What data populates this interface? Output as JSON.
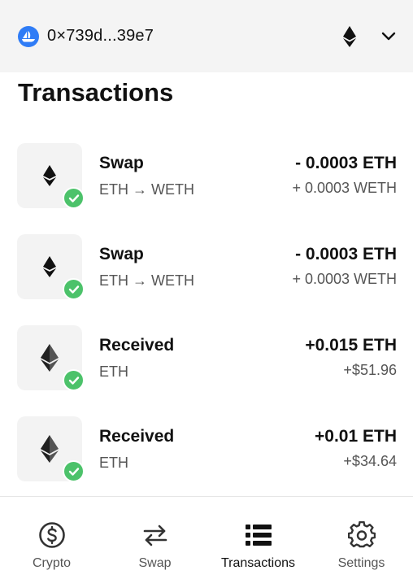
{
  "header": {
    "address": "0×739d...39e7",
    "avatar_icon": "opensea-logo",
    "network_icon": "ethereum-icon",
    "menu_icon": "chevron-down-icon"
  },
  "page": {
    "title": "Transactions"
  },
  "transactions": [
    {
      "type": "Swap",
      "detail": "ETH → WETH",
      "amount": "- 0.0003 ETH",
      "secondary": "+ 0.0003 WETH",
      "status": "success"
    },
    {
      "type": "Swap",
      "detail": "ETH → WETH",
      "amount": "- 0.0003 ETH",
      "secondary": "+ 0.0003 WETH",
      "status": "success"
    },
    {
      "type": "Received",
      "detail": "ETH",
      "amount": "+0.015 ETH",
      "secondary": "+$51.96",
      "status": "success"
    },
    {
      "type": "Received",
      "detail": "ETH",
      "amount": "+0.01 ETH",
      "secondary": "+$34.64",
      "status": "success"
    }
  ],
  "nav": {
    "items": [
      {
        "label": "Crypto",
        "icon": "dollar-circle-icon",
        "active": false
      },
      {
        "label": "Swap",
        "icon": "swap-arrows-icon",
        "active": false
      },
      {
        "label": "Transactions",
        "icon": "list-icon",
        "active": true
      },
      {
        "label": "Settings",
        "icon": "gear-icon",
        "active": false
      }
    ]
  },
  "colors": {
    "success": "#4cc26a",
    "avatar": "#2f7cf6",
    "header_bg": "#f4f4f4"
  }
}
